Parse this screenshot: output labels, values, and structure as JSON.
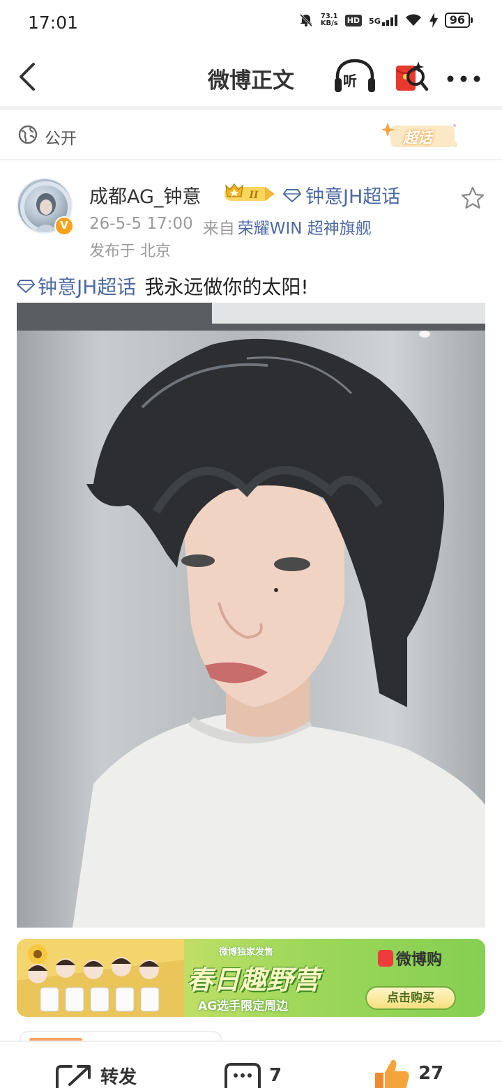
{
  "status_bar": {
    "time": "17:01",
    "net_speed_value": "73.1",
    "net_speed_unit": "KB/s",
    "hd": "HD",
    "network": "5G",
    "battery": "96"
  },
  "header": {
    "title": "微博正文",
    "listen_label": "听"
  },
  "visibility": {
    "label": "公开",
    "supertopic_badge": "超话"
  },
  "post": {
    "username": "成都AG_钟意",
    "rank_badge": "II",
    "topic_head": "钟意JH超话",
    "date": "26-5-5 17:00",
    "source_prefix": "来自",
    "source": "荣耀WIN 超神旗舰",
    "location": "发布于 北京",
    "topic_inline": "钟意JH超话",
    "text": "我永远做你的太阳!"
  },
  "ad": {
    "top_line": "微博独家发售",
    "title": "春日趣野营",
    "subtitle": "AG选手限定周边",
    "brand": "微博购",
    "cta": "点击购买"
  },
  "bottom_bar": {
    "share_label": "转发",
    "comment_count": "7",
    "like_count": "27"
  }
}
